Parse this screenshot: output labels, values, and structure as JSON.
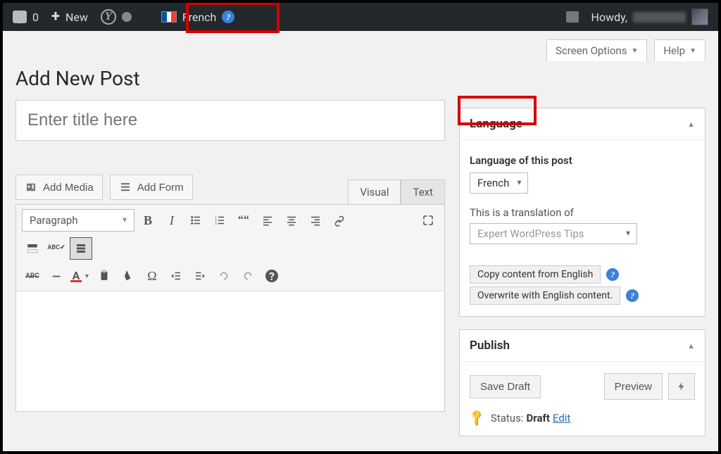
{
  "adminbar": {
    "comment_count": "0",
    "new_label": "New",
    "language_label": "French",
    "howdy_label": "Howdy,"
  },
  "top_tabs": {
    "screen_options": "Screen Options",
    "help": "Help"
  },
  "page": {
    "heading": "Add New Post",
    "title_placeholder": "Enter title here"
  },
  "media": {
    "add_media": "Add Media",
    "add_form": "Add Form"
  },
  "editor_tabs": {
    "visual": "Visual",
    "text": "Text"
  },
  "toolbar": {
    "paragraph": "Paragraph",
    "bold": "B",
    "italic": "I",
    "abc": "ABC",
    "strike": "ABC",
    "hr": "—",
    "textcolor": "A",
    "omega": "Ω",
    "help": "?"
  },
  "language_box": {
    "title": "Language",
    "field_label": "Language of this post",
    "selected": "French",
    "translation_of_label": "This is a translation of",
    "translation_of_value": "Expert WordPress Tips",
    "copy_btn": "Copy content from English",
    "overwrite_btn": "Overwrite with English content."
  },
  "publish_box": {
    "title": "Publish",
    "save_draft": "Save Draft",
    "preview": "Preview",
    "status_label": "Status:",
    "status_value": "Draft",
    "edit": "Edit"
  }
}
